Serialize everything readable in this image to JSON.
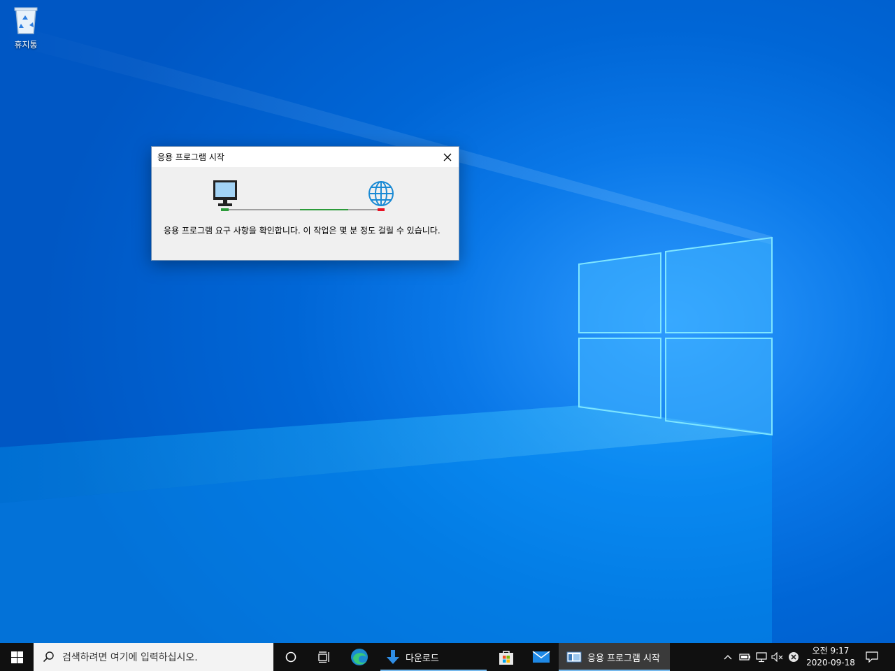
{
  "desktop": {
    "icons": [
      {
        "label": "휴지통",
        "icon": "recycle-bin-icon"
      }
    ]
  },
  "dialog": {
    "title": "응용 프로그램 시작",
    "message": "응용 프로그램 요구 사항을 확인합니다. 이 작업은 몇 분 정도 걸릴 수 있습니다.",
    "icons": {
      "left": "computer-icon",
      "right": "globe-icon"
    }
  },
  "taskbar": {
    "search_placeholder": "검색하려면 여기에 입력하십시오.",
    "items": [
      {
        "label": "다운로드",
        "icon": "download-icon"
      },
      {
        "label": "응용 프로그램 시작",
        "icon": "app-window-icon"
      }
    ],
    "clock": {
      "time": "오전 9:17",
      "date": "2020-09-18"
    }
  },
  "colors": {
    "desktop_blue": "#0a78e8",
    "taskbar": "#101010",
    "progress_green": "#2c9b3a",
    "progress_red": "#e81123"
  }
}
